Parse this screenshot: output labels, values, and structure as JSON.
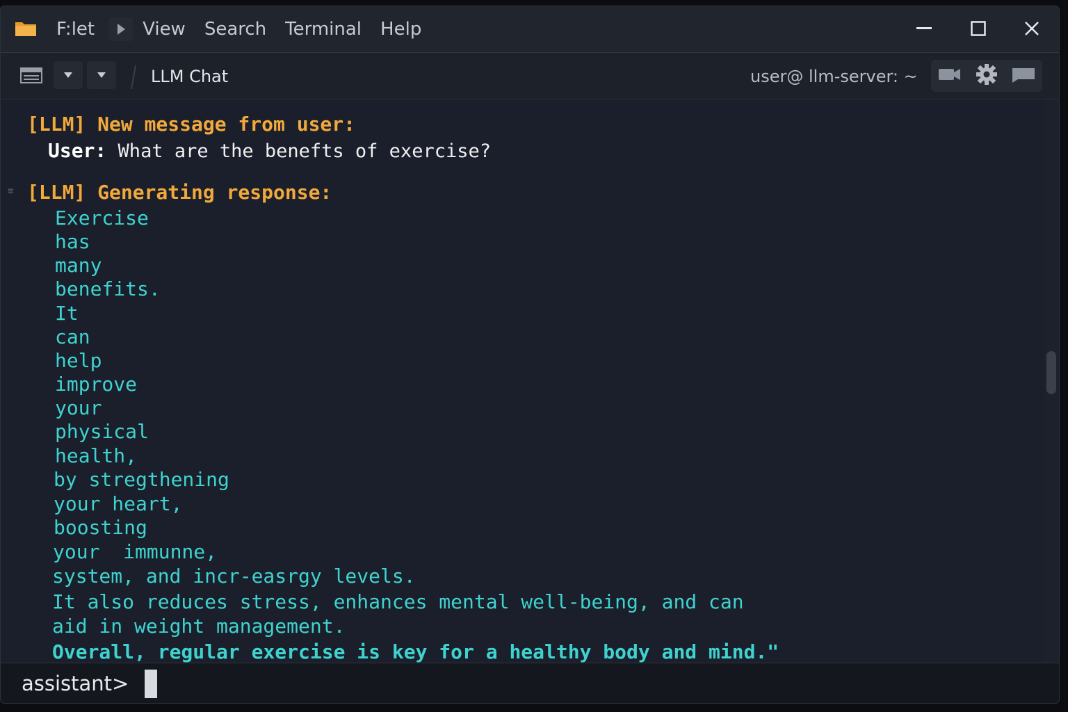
{
  "menu": {
    "items": [
      "F:let",
      "View",
      "Search",
      "Terminal",
      "Help"
    ]
  },
  "toolbar": {
    "tab_title": "LLM Chat",
    "host": "user@ llm-server: ~"
  },
  "terminal": {
    "header1": "[LLM] New message from user:",
    "user_label": "User:",
    "user_question": " What are the benefts of exercise?",
    "header2": "[LLM] Generating response:",
    "response_lines": [
      "Exercise",
      "has",
      "many",
      "benefits.",
      "It",
      "can",
      "help",
      "improve",
      "your",
      "physical",
      "health,",
      "by stregthening",
      "your heart,",
      "boosting",
      "your  immunne,",
      "system, and incr-easrgy levels.",
      "It also reduces stress, enhances mental well-being, and can",
      "aid in weight management.",
      "Overall, regular exercise is key for a healthy body and mind.\""
    ]
  },
  "prompt": {
    "text": "assistant>"
  },
  "colors": {
    "header": "#f2a93b",
    "response": "#3fd3cf",
    "background": "#1a1f2b"
  },
  "icons": [
    "folder-icon",
    "chevron-right-icon",
    "minimize-icon",
    "maximize-icon",
    "close-icon",
    "sidebar-icon",
    "dropdown-icon",
    "camera-icon",
    "gear-icon",
    "message-icon"
  ]
}
